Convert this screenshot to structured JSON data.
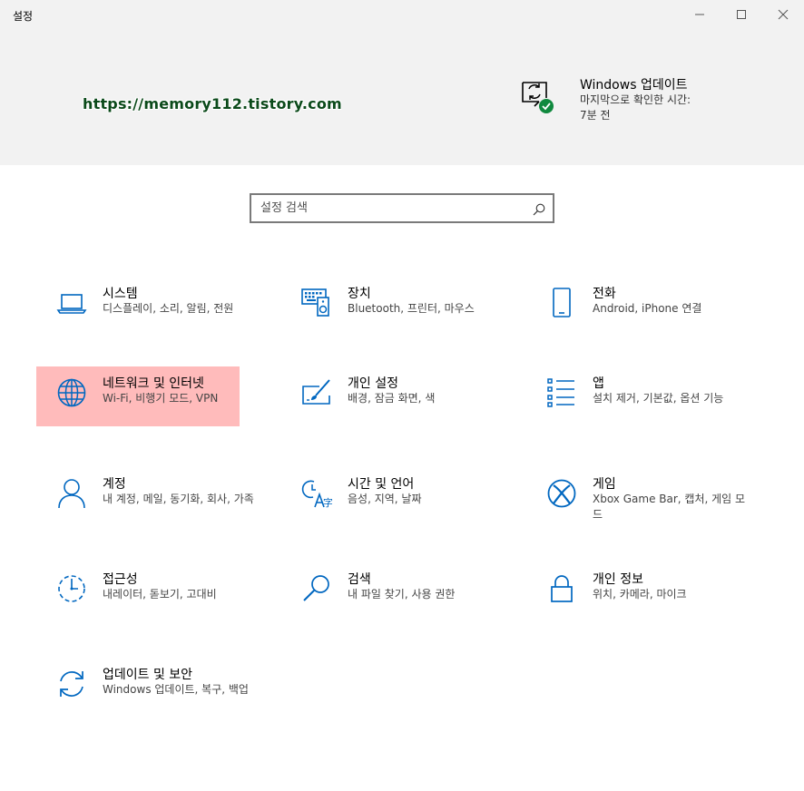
{
  "window": {
    "title": "설정",
    "controls": [
      "minimize-icon",
      "maximize-icon",
      "close-icon"
    ]
  },
  "watermark": "https://memory112.tistory.com",
  "update": {
    "title": "Windows 업데이트",
    "subtitle": "마지막으로 확인한 시간: 7분 전",
    "icon": "windows-update-check-icon"
  },
  "search": {
    "placeholder": "설정 검색",
    "value": "",
    "icon": "search-icon"
  },
  "colors": {
    "accent": "#0067c0",
    "header_bg": "#f2f2f2",
    "highlight": "#ffbbbb",
    "check_badge": "#10893e"
  },
  "categories": [
    {
      "title": "시스템",
      "desc": "디스플레이, 소리, 알림, 전원",
      "icon": "laptop-icon"
    },
    {
      "title": "장치",
      "desc": "Bluetooth, 프린터, 마우스",
      "icon": "keyboard-speaker-icon"
    },
    {
      "title": "전화",
      "desc": "Android, iPhone 연결",
      "icon": "phone-icon"
    },
    {
      "title": "네트워크 및 인터넷",
      "desc": "Wi-Fi, 비행기 모드, VPN",
      "icon": "globe-icon",
      "highlighted": true
    },
    {
      "title": "개인 설정",
      "desc": "배경, 잠금 화면, 색",
      "icon": "paint-brush-icon"
    },
    {
      "title": "앱",
      "desc": "설치 제거, 기본값, 옵션 기능",
      "icon": "app-list-icon"
    },
    {
      "title": "계정",
      "desc": "내 계정, 메일, 동기화, 회사, 가족",
      "icon": "person-icon"
    },
    {
      "title": "시간 및 언어",
      "desc": "음성, 지역, 날짜",
      "icon": "time-language-icon"
    },
    {
      "title": "게임",
      "desc": "Xbox Game Bar, 캡처, 게임 모드",
      "icon": "xbox-icon"
    },
    {
      "title": "접근성",
      "desc": "내레이터, 돋보기, 고대비",
      "icon": "ease-of-access-icon"
    },
    {
      "title": "검색",
      "desc": "내 파일 찾기, 사용 권한",
      "icon": "search-icon"
    },
    {
      "title": "개인 정보",
      "desc": "위치, 카메라, 마이크",
      "icon": "lock-icon"
    },
    {
      "title": "업데이트 및 보안",
      "desc": "Windows 업데이트, 복구, 백업",
      "icon": "sync-icon"
    }
  ]
}
